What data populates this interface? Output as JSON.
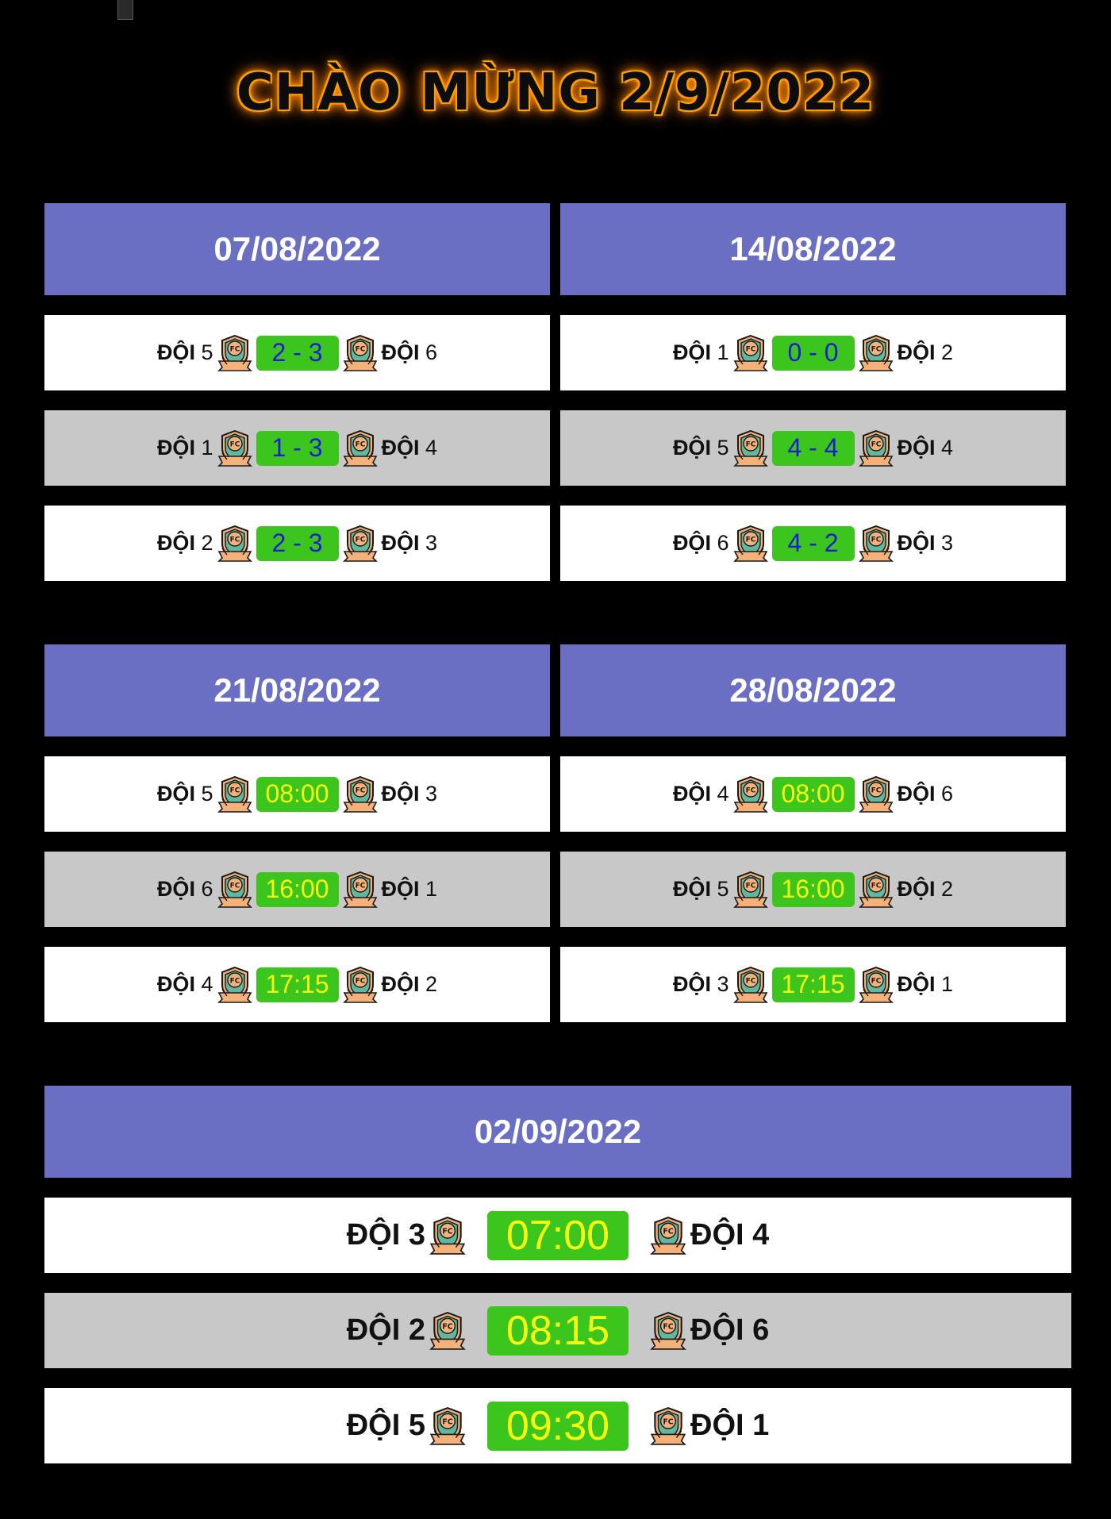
{
  "title": "CHÀO MỪNG 2/9/2022",
  "icon": "fc-shield-icon",
  "colors": {
    "header": "#6a6fc4",
    "pill": "#3cc51c",
    "score_text": "#1a1ad8",
    "time_text": "#f6ff10",
    "row_white": "#ffffff",
    "row_gray": "#c8c8c8",
    "glow": "#ff9a00"
  },
  "blocks": [
    {
      "date": "07/08/2022",
      "matches": [
        {
          "home": "ĐỘI",
          "home_num": "5",
          "value": "2 - 3",
          "away": "ĐỘI",
          "away_num": "6"
        },
        {
          "home": "ĐỘI",
          "home_num": "1",
          "value": "1 - 3",
          "away": "ĐỘI",
          "away_num": "4"
        },
        {
          "home": "ĐỘI",
          "home_num": "2",
          "value": "2 - 3",
          "away": "ĐỘI",
          "away_num": "3"
        }
      ]
    },
    {
      "date": "14/08/2022",
      "matches": [
        {
          "home": "ĐỘI",
          "home_num": "1",
          "value": "0 - 0",
          "away": "ĐỘI",
          "away_num": "2"
        },
        {
          "home": "ĐỘI",
          "home_num": "5",
          "value": "4 - 4",
          "away": "ĐỘI",
          "away_num": "4"
        },
        {
          "home": "ĐỘI",
          "home_num": "6",
          "value": "4 - 2",
          "away": "ĐỘI",
          "away_num": "3"
        }
      ]
    },
    {
      "date": "21/08/2022",
      "matches": [
        {
          "home": "ĐỘI",
          "home_num": "5",
          "value": "08:00",
          "away": "ĐỘI",
          "away_num": "3"
        },
        {
          "home": "ĐỘI",
          "home_num": "6",
          "value": "16:00",
          "away": "ĐỘI",
          "away_num": "1"
        },
        {
          "home": "ĐỘI",
          "home_num": "4",
          "value": "17:15",
          "away": "ĐỘI",
          "away_num": "2"
        }
      ]
    },
    {
      "date": "28/08/2022",
      "matches": [
        {
          "home": "ĐỘI",
          "home_num": "4",
          "value": "08:00",
          "away": "ĐỘI",
          "away_num": "6"
        },
        {
          "home": "ĐỘI",
          "home_num": "5",
          "value": "16:00",
          "away": "ĐỘI",
          "away_num": "2"
        },
        {
          "home": "ĐỘI",
          "home_num": "3",
          "value": "17:15",
          "away": "ĐỘI",
          "away_num": "1"
        }
      ]
    },
    {
      "date": "02/09/2022",
      "matches": [
        {
          "home": "ĐỘI",
          "home_num": "3",
          "value": "07:00",
          "away": "ĐỘI",
          "away_num": "4"
        },
        {
          "home": "ĐỘI",
          "home_num": "2",
          "value": "08:15",
          "away": "ĐỘI",
          "away_num": "6"
        },
        {
          "home": "ĐỘI",
          "home_num": "5",
          "value": "09:30",
          "away": "ĐỘI",
          "away_num": "1"
        }
      ]
    }
  ]
}
